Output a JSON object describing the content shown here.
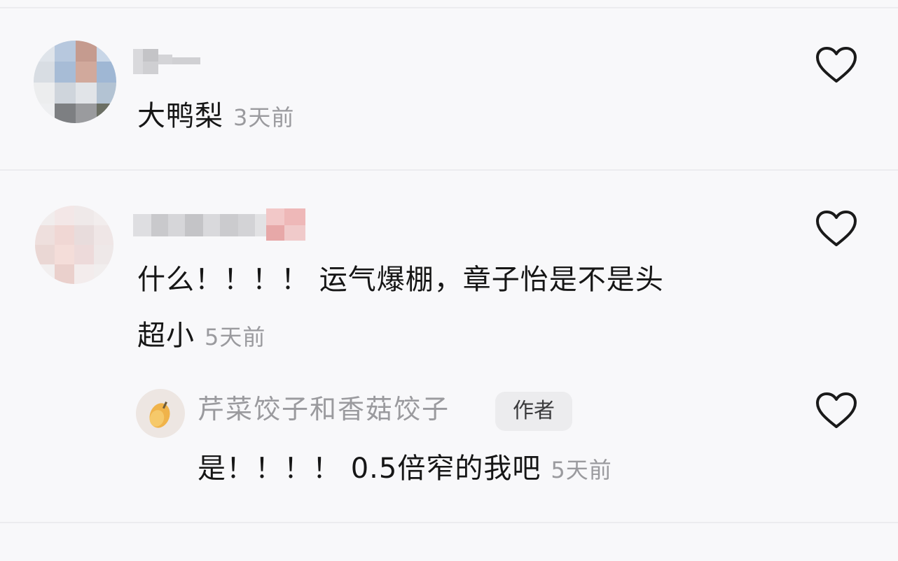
{
  "comments": [
    {
      "text": "大鸭梨",
      "time": "3天前",
      "like_icon": "heart-outline-icon"
    },
    {
      "text_line1": "什么！！！！ 运气爆棚，章子怡是不是头",
      "text_line2": "超小",
      "time": "5天前",
      "like_icon": "heart-outline-icon",
      "reply": {
        "username": "芹菜饺子和香菇饺子",
        "badge": "作者",
        "text": "是！！！！ 0.5倍窄的我吧",
        "time": "5天前",
        "like_icon": "heart-outline-icon"
      }
    }
  ],
  "colors": {
    "background": "#f8f8fa",
    "text": "#161616",
    "muted": "#9a9a9e",
    "divider": "#ececef",
    "badge_bg": "#ececee"
  }
}
